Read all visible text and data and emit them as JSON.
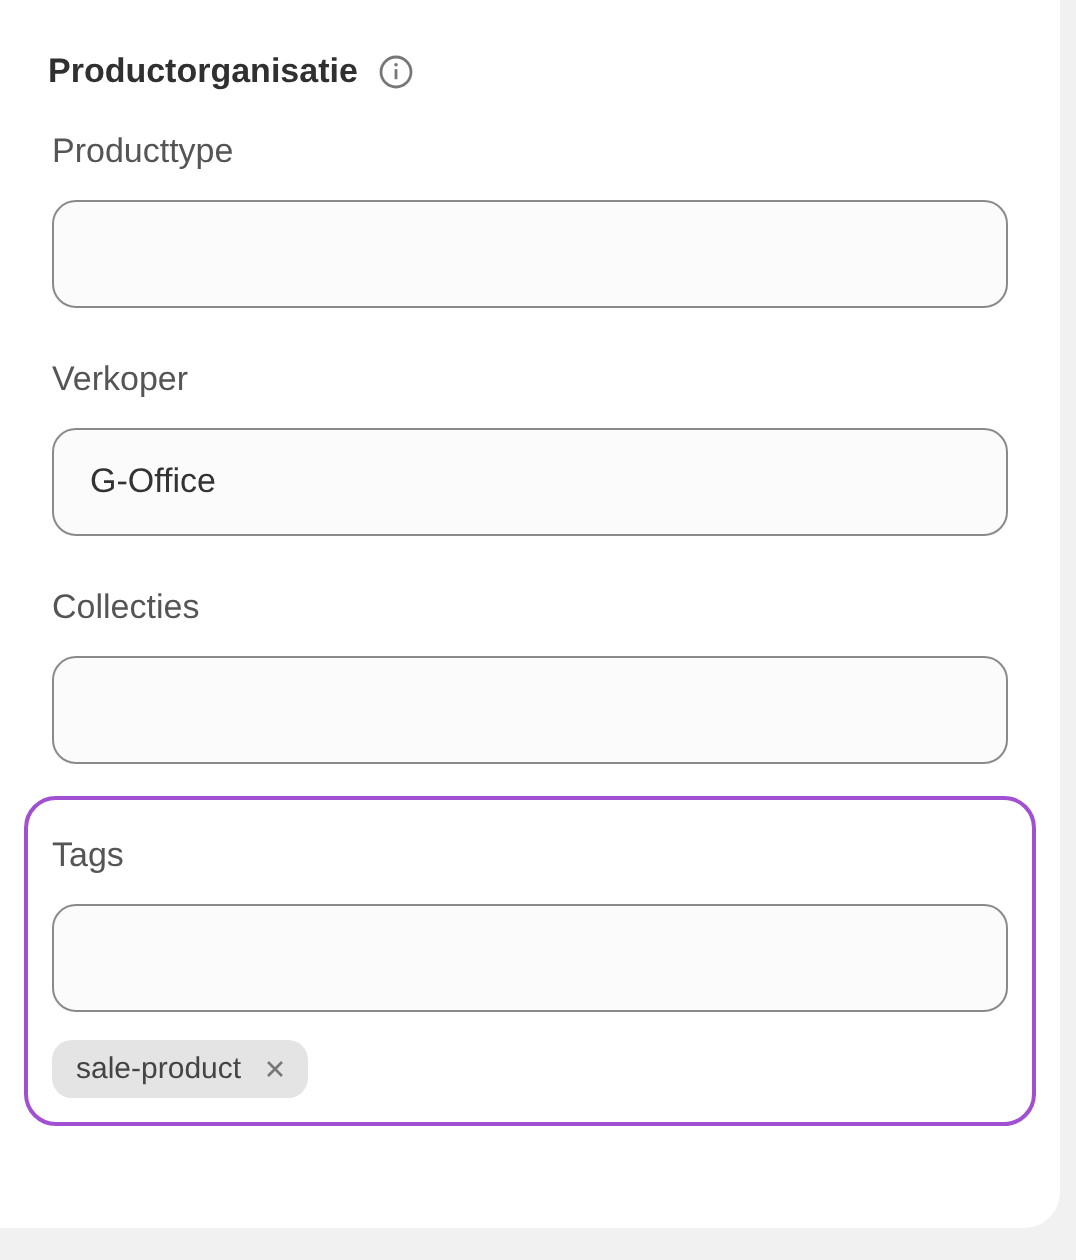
{
  "card": {
    "title": "Productorganisatie",
    "fields": [
      {
        "label": "Producttype",
        "highlighted": false
      },
      {
        "label": "Verkoper",
        "value": "G-Office",
        "highlighted": false
      },
      {
        "label": "Collecties",
        "highlighted": false
      },
      {
        "label": "Tags",
        "highlighted": true,
        "tags": [
          "sale-product"
        ]
      }
    ]
  }
}
